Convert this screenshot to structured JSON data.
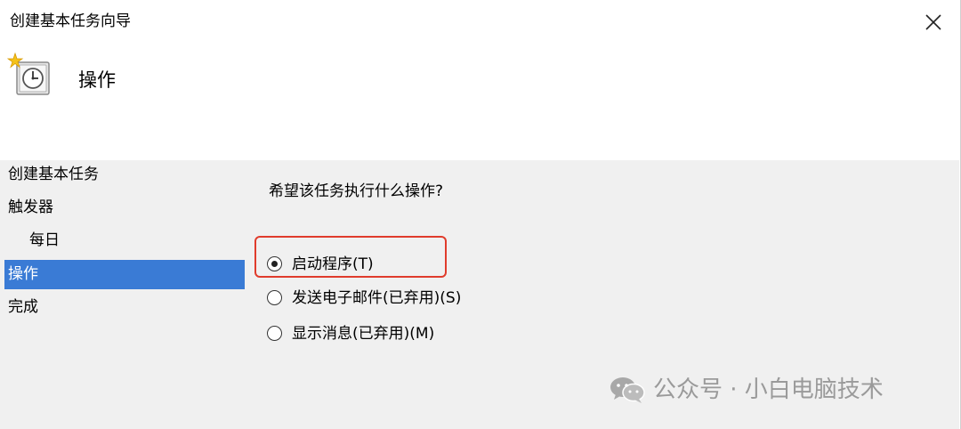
{
  "window": {
    "title": "创建基本任务向导",
    "close_icon": "close-icon"
  },
  "header": {
    "icon": "scheduled-task-clock-icon",
    "title": "操作"
  },
  "sidebar": {
    "steps": [
      {
        "label": "创建基本任务"
      },
      {
        "label": "触发器"
      },
      {
        "label": "每日"
      },
      {
        "label": "操作"
      },
      {
        "label": "完成"
      }
    ],
    "active_index": 3,
    "active_color": "#3a7bd5"
  },
  "content": {
    "question": "希望该任务执行什么操作?",
    "options": [
      {
        "label": "启动程序(T)",
        "checked": true
      },
      {
        "label": "发送电子邮件(已弃用)(S)",
        "checked": false
      },
      {
        "label": "显示消息(已弃用)(M)",
        "checked": false
      }
    ]
  },
  "annotation": {
    "color": "#e03c2c"
  },
  "watermark": {
    "icon": "wechat-icon",
    "text": "公众号 · 小白电脑技术"
  }
}
